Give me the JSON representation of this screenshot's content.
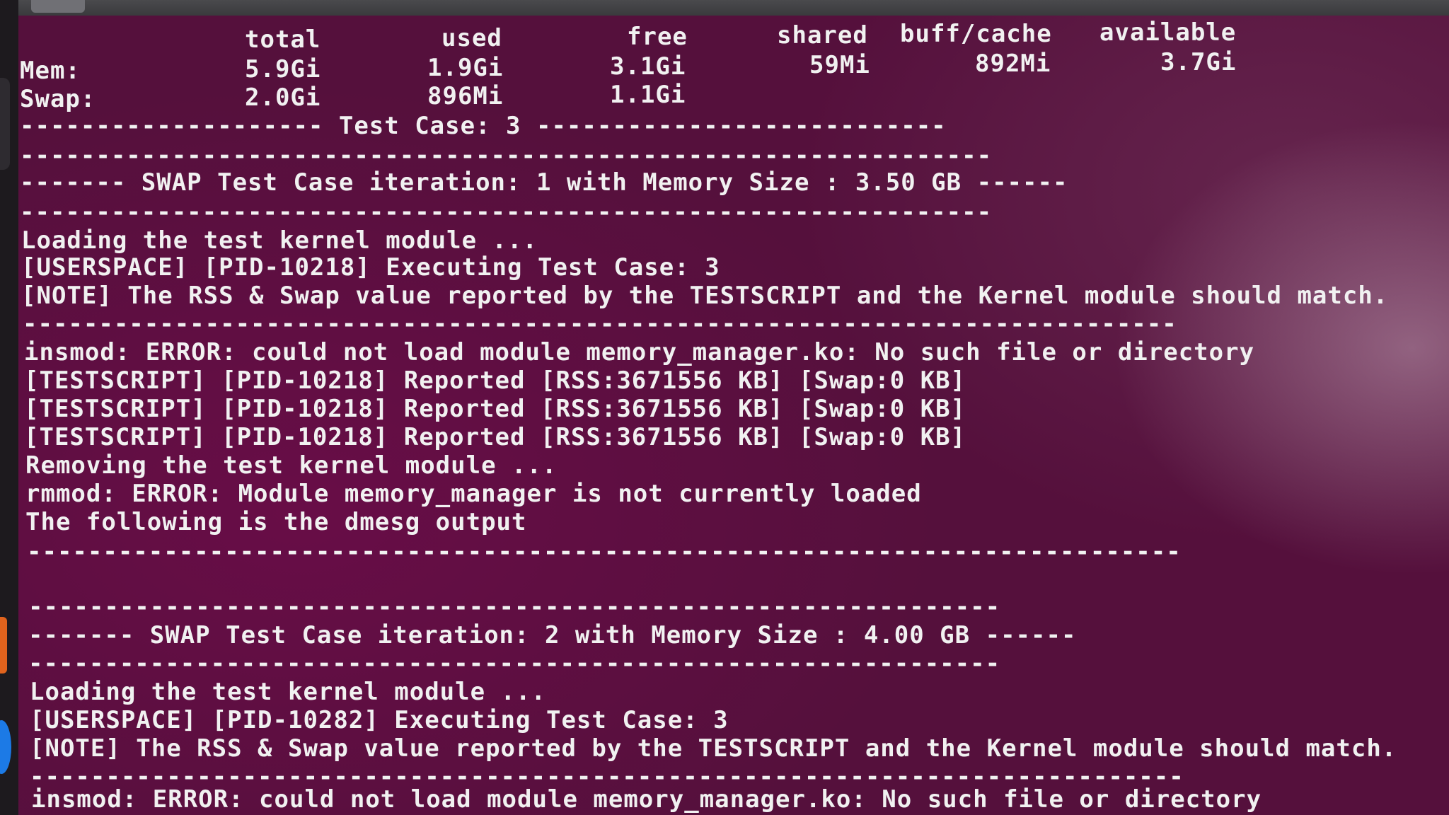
{
  "free_output": {
    "headers": [
      "total",
      "used",
      "free",
      "shared",
      "buff/cache",
      "available"
    ],
    "mem_label": "Mem:",
    "mem": [
      "5.9Gi",
      "1.9Gi",
      "3.1Gi",
      "59Mi",
      "892Mi",
      "3.7Gi"
    ],
    "swap_label": "Swap:",
    "swap": [
      "2.0Gi",
      "896Mi",
      "1.1Gi"
    ]
  },
  "lines": {
    "test_case_banner": "-------------------- Test Case: 3 ---------------------------",
    "sep1a": "----------------------------------------------------------------",
    "iter1": "------- SWAP Test Case iteration: 1 with Memory Size : 3.50 GB ------",
    "sep1b": "----------------------------------------------------------------",
    "load1": "Loading the test kernel module ...",
    "exec1": "[USERSPACE] [PID-10218] Executing Test Case: 3",
    "note1": "[NOTE] The RSS & Swap value reported by the TESTSCRIPT and the Kernel module should match.",
    "sep1c": "----------------------------------------------------------------------------",
    "insmod1": "insmod: ERROR: could not load module memory_manager.ko: No such file or directory",
    "rep1": "[TESTSCRIPT] [PID-10218] Reported [RSS:3671556 KB] [Swap:0 KB]",
    "rep2": "[TESTSCRIPT] [PID-10218] Reported [RSS:3671556 KB] [Swap:0 KB]",
    "rep3": "[TESTSCRIPT] [PID-10218] Reported [RSS:3671556 KB] [Swap:0 KB]",
    "remove1": "Removing the test kernel module ...",
    "rmmod1": "rmmod: ERROR: Module memory_manager is not currently loaded",
    "dmesg1": "The following is the dmesg output",
    "sep1d": "----------------------------------------------------------------------------",
    "sep2a": "----------------------------------------------------------------",
    "iter2": "------- SWAP Test Case iteration: 2 with Memory Size : 4.00 GB ------",
    "sep2b": "----------------------------------------------------------------",
    "load2": "Loading the test kernel module ...",
    "exec2": "[USERSPACE] [PID-10282] Executing Test Case: 3",
    "note2": "[NOTE] The RSS & Swap value reported by the TESTSCRIPT and the Kernel module should match.",
    "sep2c": "----------------------------------------------------------------------------",
    "insmod2": "insmod: ERROR: could not load module memory_manager.ko: No such file or directory"
  },
  "colors": {
    "terminal_bg": "#55103c",
    "text": "#f1f1f1",
    "dock_orange": "#e0631d",
    "dock_blue": "#1c7ae6"
  }
}
